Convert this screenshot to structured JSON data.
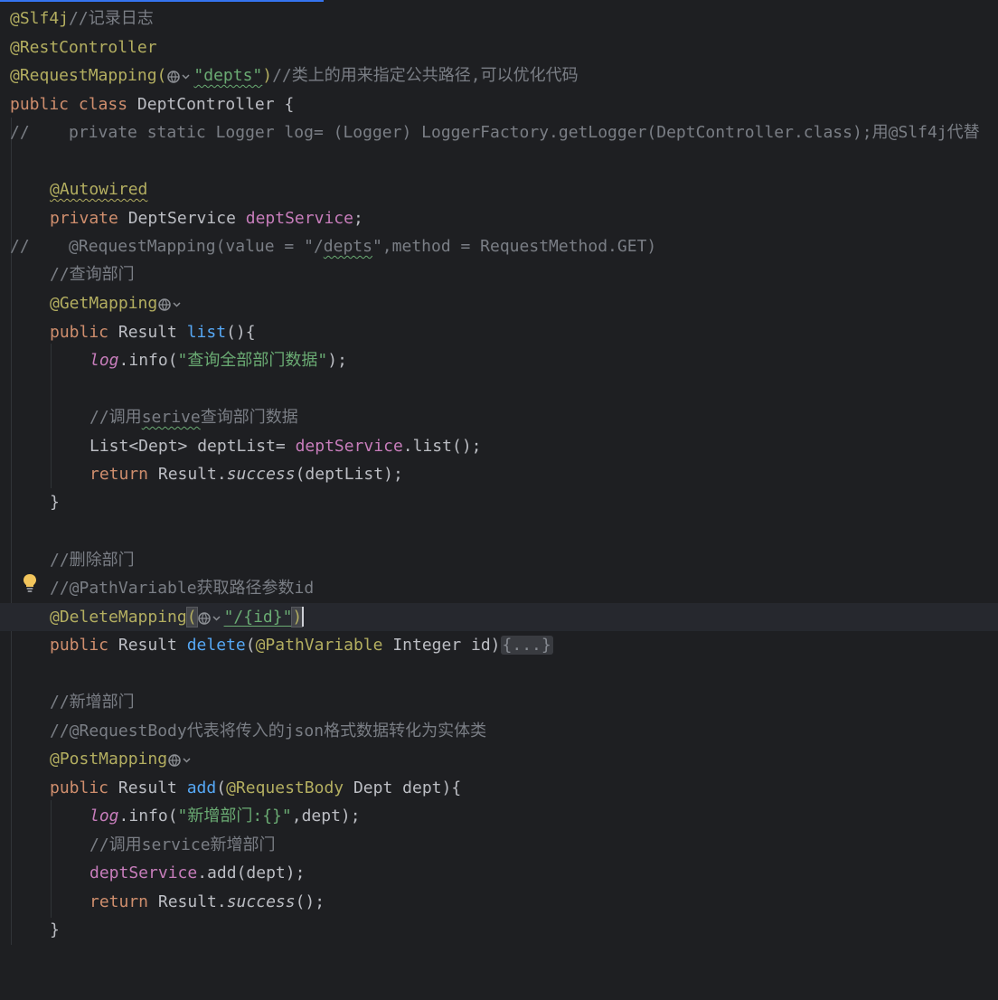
{
  "editor": {
    "language": "java",
    "lines": {
      "l01_a": "@Slf4j",
      "l01_b": "//记录日志",
      "l02": "@RestController",
      "l03_a": "@RequestMapping(",
      "l03_b": "\"depts\"",
      "l03_c": ")",
      "l03_d": "//类上的用来指定公共路径,可以优化代码",
      "l04_a": "public class ",
      "l04_b": "DeptController {",
      "l05": "//    private static Logger log= (Logger) LoggerFactory.getLogger(DeptController.class);用@Slf4j代替",
      "l07": "@Autowired",
      "l08_a": "private ",
      "l08_b": "DeptService ",
      "l08_c": "deptService",
      "l08_d": ";",
      "l09_a": "//    @RequestMapping(value = \"/",
      "l09_b": "depts",
      "l09_c": "\",method = RequestMethod.GET)",
      "l10": "//查询部门",
      "l11": "@GetMapping",
      "l12_a": "public ",
      "l12_b": "Result ",
      "l12_c": "list",
      "l12_d": "(){",
      "l13_a": "log",
      "l13_b": ".info(",
      "l13_c": "\"查询全部部门数据\"",
      "l13_d": ");",
      "l15_a": "//调用",
      "l15_b": "serive",
      "l15_c": "查询部门数据",
      "l16_a": "List<Dept> deptList= ",
      "l16_b": "deptService",
      "l16_c": ".list();",
      "l17_a": "return ",
      "l17_b": "Result.",
      "l17_c": "success",
      "l17_d": "(deptList);",
      "l18": "}",
      "l20": "//删除部门",
      "l21": "//@PathVariable获取路径参数id",
      "l22_a": "@DeleteMapping",
      "l22_b": "(",
      "l22_c": "\"/{id}\"",
      "l22_d": ")",
      "l23_a": "public ",
      "l23_b": "Result ",
      "l23_c": "delete",
      "l23_d": "(",
      "l23_e": "@PathVariable ",
      "l23_f": "Integer id)",
      "l23_g": "{...}",
      "l25": "//新增部门",
      "l26": "//@RequestBody代表将传入的json格式数据转化为实体类",
      "l27": "@PostMapping",
      "l28_a": "public ",
      "l28_b": "Result ",
      "l28_c": "add",
      "l28_d": "(",
      "l28_e": "@RequestBody ",
      "l28_f": "Dept dept){",
      "l29_a": "log",
      "l29_b": ".info(",
      "l29_c": "\"新增部门:{}\"",
      "l29_d": ",dept);",
      "l30": "//调用service新增部门",
      "l31_a": "deptService",
      "l31_b": ".add(dept);",
      "l32_a": "return ",
      "l32_b": "Result.",
      "l32_c": "success",
      "l32_d": "();",
      "l33": "}"
    }
  },
  "icons": {
    "web_endpoint": "globe-dropdown-icon",
    "intention": "lightbulb-icon"
  },
  "colors": {
    "background": "#1e1f22",
    "keyword": "#cf8e6d",
    "annotation": "#b3ae60",
    "string": "#6aab73",
    "comment": "#7a7e85",
    "field": "#c77dbb",
    "function": "#56a8f5",
    "text": "#bcbec4"
  }
}
